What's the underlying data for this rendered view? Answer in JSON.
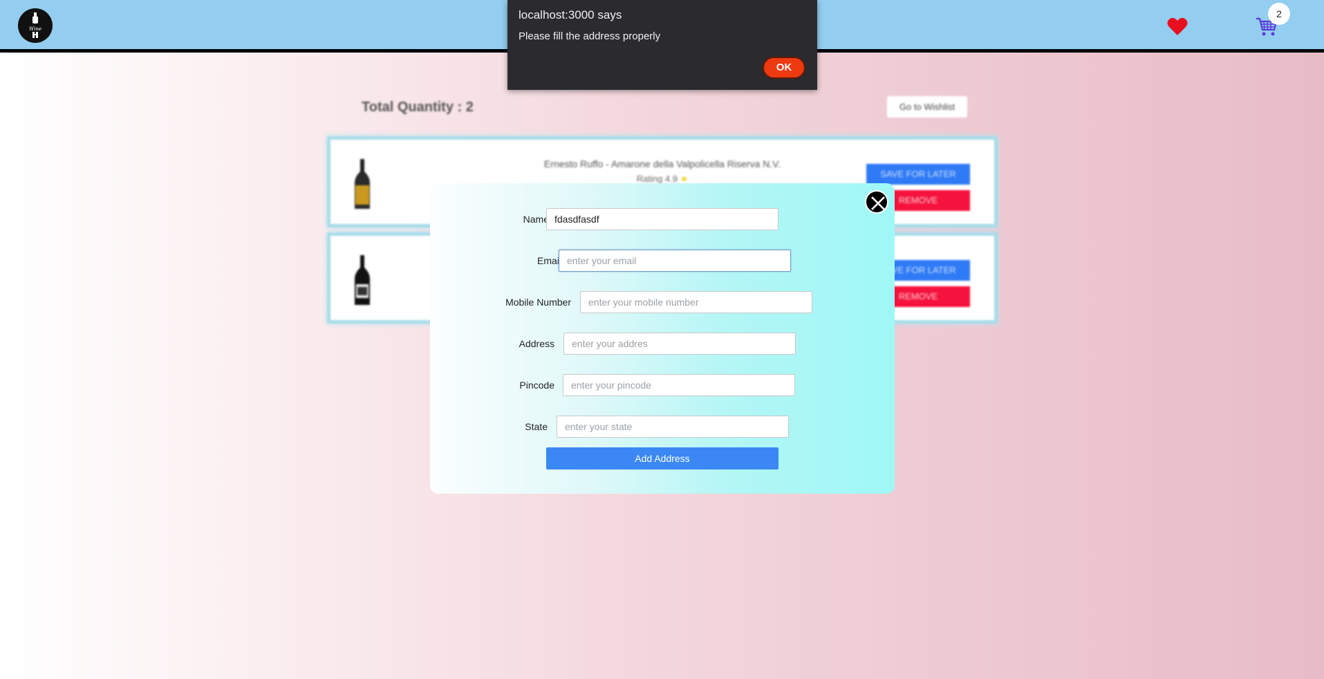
{
  "header": {
    "logo_text": "Wine",
    "cart_count": "2",
    "colors": {
      "bar": "#93cdef",
      "heart": "#e8101e",
      "cart": "#5a3ad9"
    }
  },
  "cart_page": {
    "total_quantity_label": "Total Quantity : 2",
    "wishlist_button": "Go to Wishlist",
    "items": [
      {
        "name": "Ernesto Ruffo  -  Amarone della Valpolicella Riserva N.V.",
        "rating": "Rating 4.9",
        "save_label": "SAVE FOR LATER",
        "remove_label": "REMOVE",
        "bottle_color": "#c9981e"
      },
      {
        "name": "",
        "rating": "",
        "save_label": "SAVE FOR LATER",
        "remove_label": "REMOVE",
        "bottle_color": "#111111"
      }
    ]
  },
  "address_form": {
    "name": {
      "label": "Name",
      "value": "fdasdfasdf",
      "placeholder": ""
    },
    "email": {
      "label": "Email",
      "value": "",
      "placeholder": "enter your email"
    },
    "mobile": {
      "label": "Mobile Number",
      "value": "",
      "placeholder": "enter your mobile number"
    },
    "address": {
      "label": "Address",
      "value": "",
      "placeholder": "enter your addres"
    },
    "pincode": {
      "label": "Pincode",
      "value": "",
      "placeholder": "enter your pincode"
    },
    "state": {
      "label": "State",
      "value": "",
      "placeholder": "enter your state"
    },
    "submit_label": "Add Address"
  },
  "alert": {
    "title": "localhost:3000 says",
    "message": "Please fill the address properly",
    "ok_label": "OK"
  }
}
